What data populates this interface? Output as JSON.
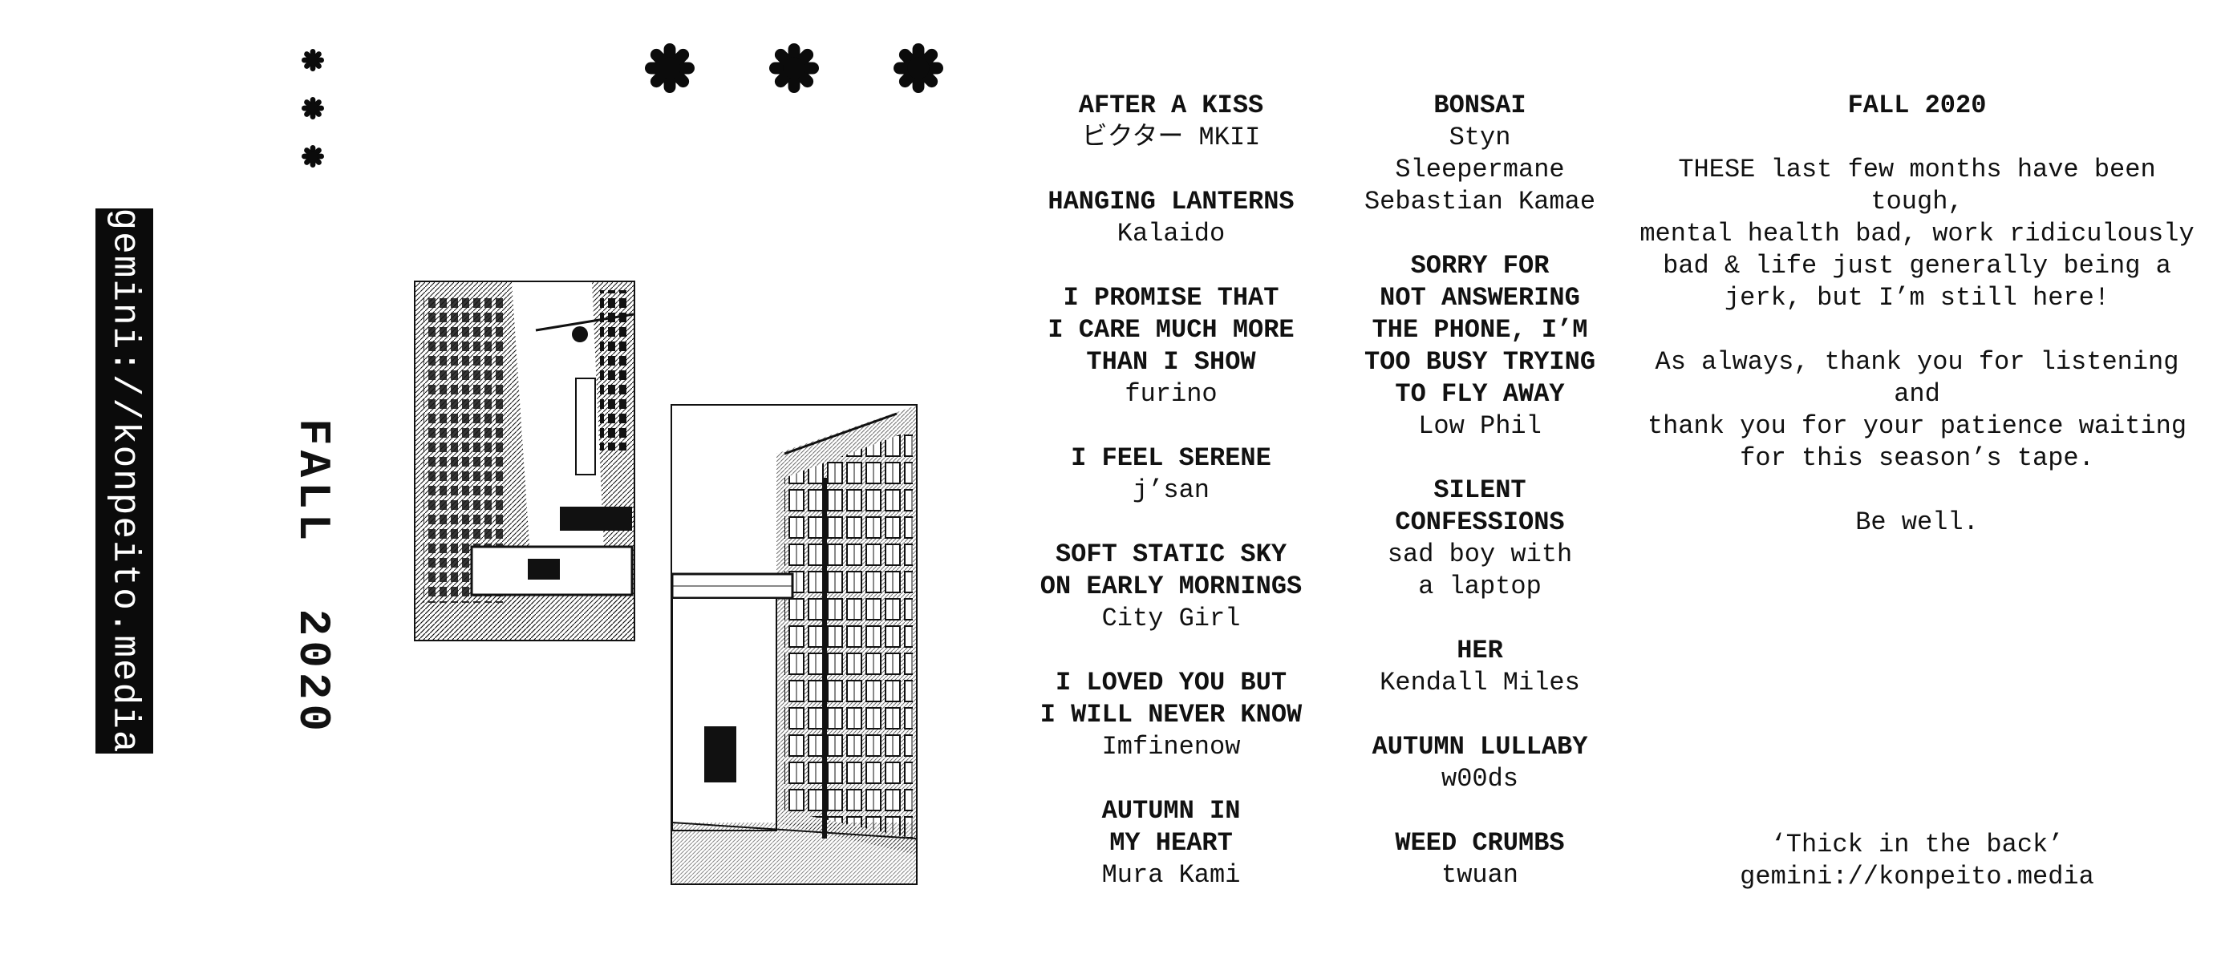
{
  "spine": {
    "url": "gemini://konpeito.media",
    "season": "FALL  2020"
  },
  "colors": {
    "ink": "#111111",
    "paper": "#ffffff"
  },
  "icons": [
    "flower-asterisk-icon"
  ],
  "tracklist": {
    "column1": [
      {
        "title": "AFTER A KISS",
        "artist": "ビクター MKII"
      },
      {
        "title": "HANGING LANTERNS",
        "artist": "Kalaido"
      },
      {
        "title": "I PROMISE THAT\nI CARE MUCH MORE\nTHAN I SHOW",
        "artist": "furino"
      },
      {
        "title": "I FEEL SERENE",
        "artist": "j’san"
      },
      {
        "title": "SOFT  STATIC  SKY\nON EARLY MORNINGS",
        "artist": "City Girl"
      },
      {
        "title": "I LOVED YOU BUT\nI WILL NEVER KNOW",
        "artist": "Imfinenow"
      },
      {
        "title": "AUTUMN IN\nMY HEART",
        "artist": "Mura Kami"
      }
    ],
    "column2": [
      {
        "title": "BONSAI",
        "artist": "Styn\nSleepermane\nSebastian Kamae"
      },
      {
        "title": "SORRY FOR\nNOT ANSWERING\nTHE  PHONE,  I’M\nTOO  BUSY  TRYING\nTO FLY AWAY",
        "artist": "Low Phil"
      },
      {
        "title": "SILENT\nCONFESSIONS",
        "artist": "sad boy with\na laptop"
      },
      {
        "title": "HER",
        "artist": "Kendall Miles"
      },
      {
        "title": "AUTUMN LULLABY",
        "artist": "w00ds"
      },
      {
        "title": "WEED CRUMBS",
        "artist": "twuan"
      }
    ]
  },
  "notes": {
    "title": "FALL 2020",
    "paragraph1": "THESE last few months have been tough,\nmental health bad, work ridiculously\nbad & life just generally being a\njerk, but I’m still here!",
    "paragraph2": "As always, thank you for listening and\nthank you for your patience waiting\nfor this season’s tape.",
    "paragraph3": "Be well.",
    "footer_line1": "‘Thick in the back’",
    "footer_line2": "gemini://konpeito.media"
  }
}
